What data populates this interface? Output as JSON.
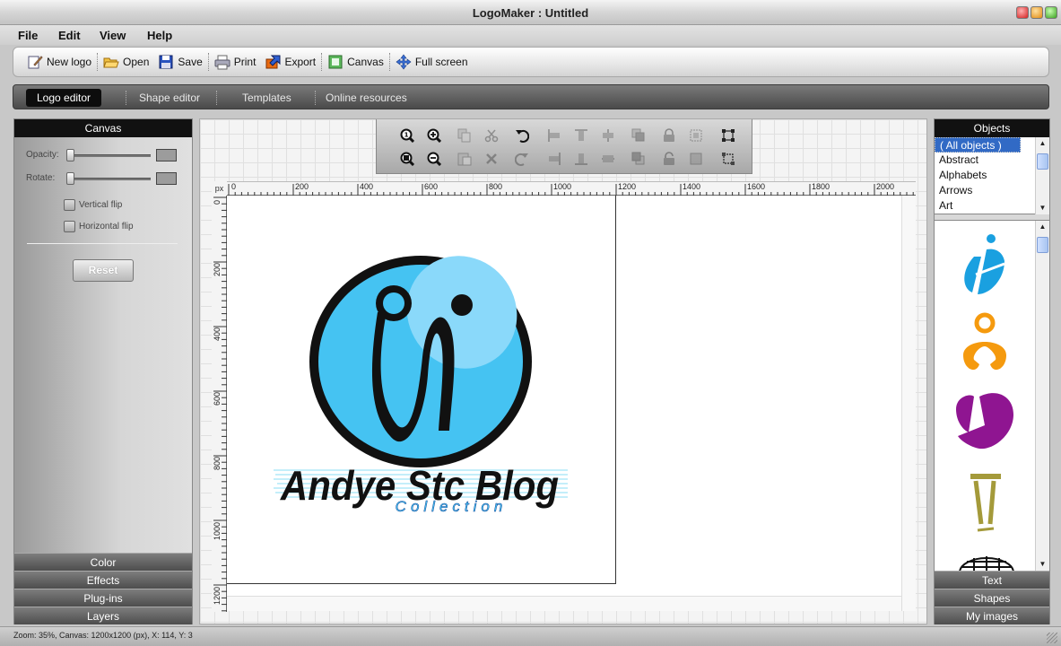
{
  "window": {
    "title": "LogoMaker : Untitled"
  },
  "menu": [
    "File",
    "Edit",
    "View",
    "Help"
  ],
  "toolbar": {
    "new_logo": "New logo",
    "open": "Open",
    "save": "Save",
    "print": "Print",
    "export": "Export",
    "canvas": "Canvas",
    "full_screen": "Full screen"
  },
  "tabs": [
    "Logo editor",
    "Shape editor",
    "Templates",
    "Online resources"
  ],
  "left_panel": {
    "header": "Canvas",
    "opacity_label": "Opacity:",
    "rotate_label": "Rotate:",
    "vertical_flip": "Vertical flip",
    "horizontal_flip": "Horizontal flip",
    "reset": "Reset",
    "sections": [
      "Color",
      "Effects",
      "Plug-ins",
      "Layers"
    ]
  },
  "ruler": {
    "unit": "px",
    "h_ticks": [
      "0",
      "200",
      "400",
      "600",
      "800",
      "1000",
      "1200",
      "1400",
      "1600",
      "1800",
      "2000"
    ],
    "v_ticks": [
      "0",
      "200",
      "400",
      "600",
      "800",
      "1000",
      "1200"
    ]
  },
  "logo": {
    "main_text": "Andye Stc Blog",
    "sub_text": "Collection"
  },
  "colors": {
    "logo_blue": "#45c3f2",
    "logo_highlight": "#8ad9fa",
    "orange": "#f59a0e",
    "purple": "#8f1591",
    "olive": "#a49a3a"
  },
  "right_panel": {
    "header": "Objects",
    "categories": [
      "( All objects )",
      "Abstract",
      "Alphabets",
      "Arrows",
      "Art"
    ],
    "gallery_icons": [
      "blue-abstract-i-icon",
      "orange-knot-icon",
      "purple-shield-icon",
      "olive-pillar-icon",
      "black-globe-icon"
    ],
    "sections": [
      "Text",
      "Shapes",
      "My images"
    ]
  },
  "status": {
    "text": "Zoom: 35%, Canvas: 1200x1200 (px), X: 114, Y: 3"
  }
}
